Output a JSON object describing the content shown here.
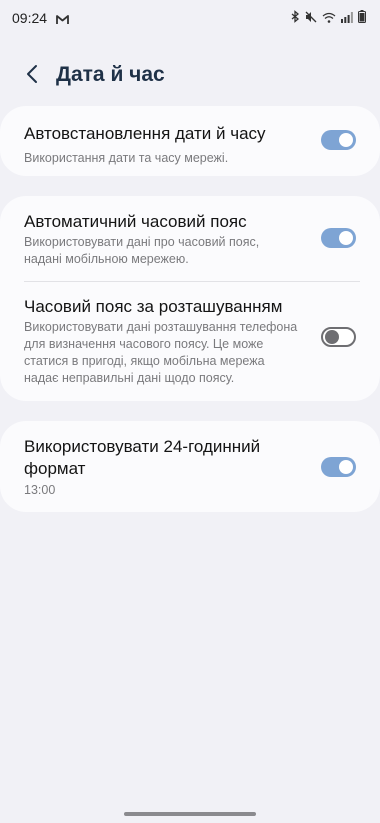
{
  "status_bar": {
    "time": "09:24",
    "icons": [
      "gmail-icon",
      "bluetooth-icon",
      "mute-icon",
      "wifi-icon",
      "signal-icon",
      "battery-icon"
    ]
  },
  "header": {
    "title": "Дата й час",
    "back_icon": "chevron-left-icon"
  },
  "settings": {
    "auto_datetime": {
      "title": "Автовстановлення дати й часу",
      "subtitle": "Використання дати та часу мережі.",
      "enabled": true
    },
    "auto_timezone": {
      "title": "Автоматичний часовий пояс",
      "subtitle": "Використовувати дані про часовий пояс, надані мобільною мережею.",
      "enabled": true
    },
    "location_timezone": {
      "title": "Часовий пояс за розташуванням",
      "subtitle": "Використовувати дані розташування телефона для визначення часового поясу. Це може статися в пригоді, якщо мобільна мережа надає неправильні дані щодо поясу.",
      "enabled": false
    },
    "format_24h": {
      "title": "Використовувати 24-годинний формат",
      "subtitle": "13:00",
      "enabled": true
    }
  },
  "colors": {
    "accent": "#7ea4d4",
    "background": "#f1f1f6",
    "card": "#fbfbfd",
    "title": "#1f3147"
  }
}
